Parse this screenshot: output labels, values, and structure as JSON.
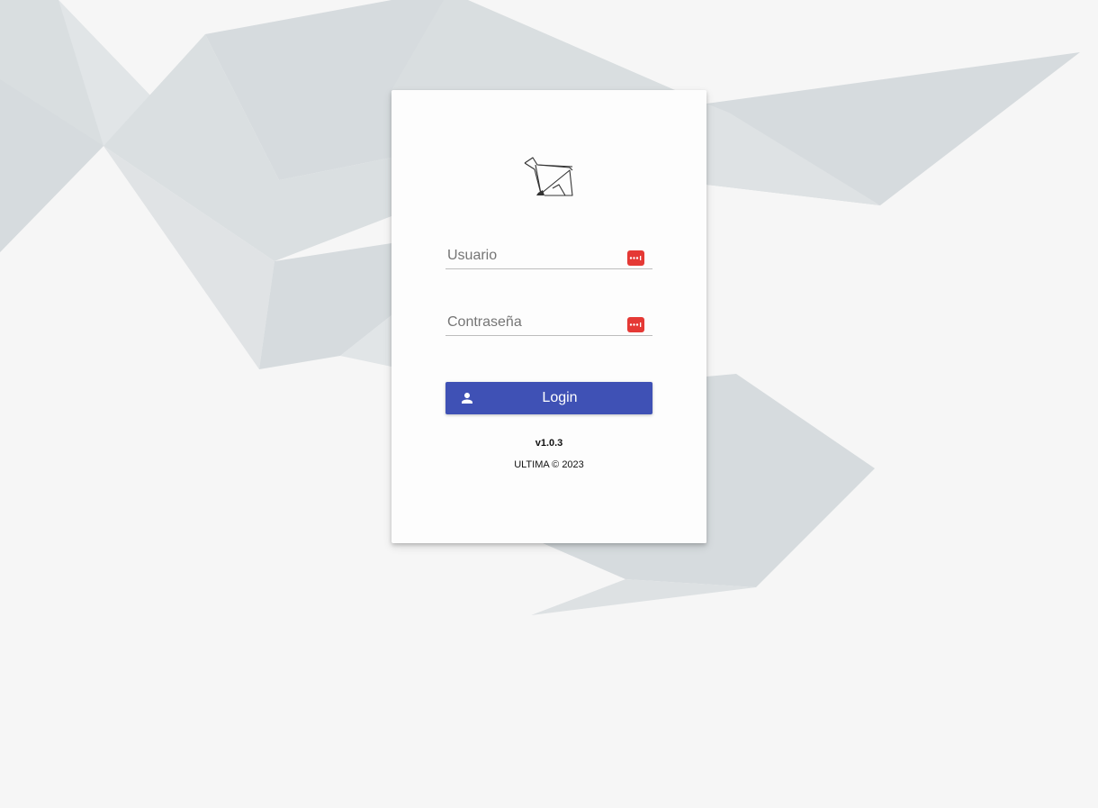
{
  "login": {
    "username_placeholder": "Usuario",
    "password_placeholder": "Contraseña",
    "login_button_label": "Login",
    "login_button_icon": "user-icon",
    "field_icon": "password-manager-icon",
    "logo": "origami-bird-logo"
  },
  "footer": {
    "version": "v1.0.3",
    "copyright": "ULTIMA © 2023"
  },
  "colors": {
    "background": "#f6f6f6",
    "shapes": "#d6dbde",
    "card": "#fdfdfd",
    "primary": "#3f51b5",
    "field_icon": "#e53935"
  }
}
